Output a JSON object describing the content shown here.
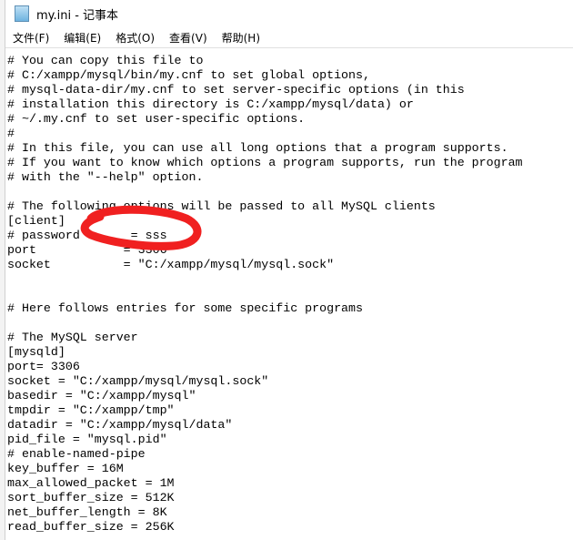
{
  "window": {
    "title": "my.ini - 记事本",
    "icon": "notepad-icon"
  },
  "menu": [
    {
      "label": "文件(F)"
    },
    {
      "label": "编辑(E)"
    },
    {
      "label": "格式(O)"
    },
    {
      "label": "查看(V)"
    },
    {
      "label": "帮助(H)"
    }
  ],
  "editor": {
    "lines": [
      "# You can copy this file to",
      "# C:/xampp/mysql/bin/my.cnf to set global options,",
      "# mysql-data-dir/my.cnf to set server-specific options (in this",
      "# installation this directory is C:/xampp/mysql/data) or",
      "# ~/.my.cnf to set user-specific options.",
      "#",
      "# In this file, you can use all long options that a program supports.",
      "# If you want to know which options a program supports, run the program",
      "# with the \"--help\" option.",
      "",
      "# The following options will be passed to all MySQL clients",
      "[client]",
      "# password       = sss",
      "port            = 3306",
      "socket          = \"C:/xampp/mysql/mysql.sock\"",
      "",
      "",
      "# Here follows entries for some specific programs",
      "",
      "# The MySQL server",
      "[mysqld]",
      "port= 3306",
      "socket = \"C:/xampp/mysql/mysql.sock\"",
      "basedir = \"C:/xampp/mysql\"",
      "tmpdir = \"C:/xampp/tmp\"",
      "datadir = \"C:/xampp/mysql/data\"",
      "pid_file = \"mysql.pid\"",
      "# enable-named-pipe",
      "key_buffer = 16M",
      "max_allowed_packet = 1M",
      "sort_buffer_size = 512K",
      "net_buffer_length = 8K",
      "read_buffer_size = 256K"
    ]
  },
  "annotation_color": "#f02020"
}
